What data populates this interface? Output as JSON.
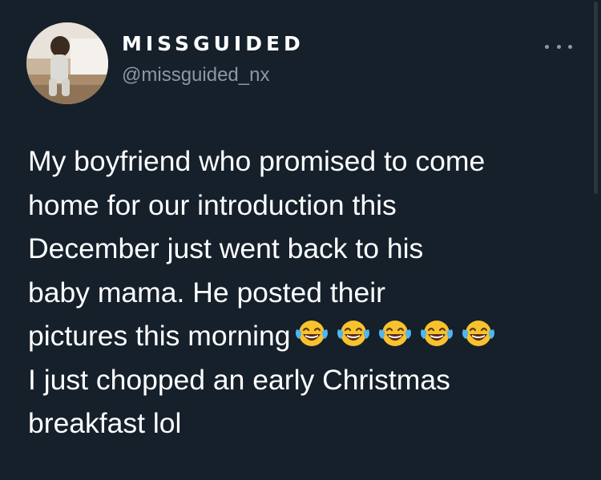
{
  "author": {
    "display_name": "MISSGUIDED",
    "handle": "@missguided_nx",
    "avatar_icon": "toddler-photo-avatar"
  },
  "menu": {
    "icon": "more-options-icon"
  },
  "tweet": {
    "lines": [
      "My boyfriend who promised to come",
      "home for our introduction this",
      "December just went back to his",
      "baby mama. He posted their",
      "pictures this morning",
      "I just chopped an early Christmas",
      "breakfast lol"
    ],
    "emoji_icon": "face-with-tears-of-joy-icon",
    "emoji_count": 5
  },
  "colors": {
    "background": "#15202b",
    "text_primary": "#ffffff",
    "text_secondary": "#8b98a5"
  }
}
